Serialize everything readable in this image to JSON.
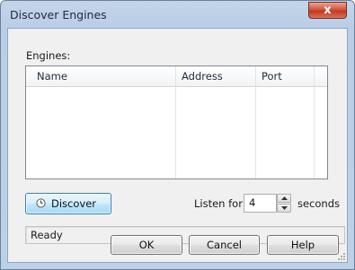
{
  "window": {
    "title": "Discover Engines",
    "close_glyph": "x"
  },
  "engines": {
    "label": "Engines:",
    "columns": [
      "Name",
      "Address",
      "Port"
    ],
    "rows": []
  },
  "discover": {
    "label": "Discover",
    "icon": "clock-icon"
  },
  "listen": {
    "label": "Listen for",
    "value": "4",
    "unit": "seconds"
  },
  "status": {
    "text": "Ready"
  },
  "buttons": {
    "ok": "OK",
    "cancel": "Cancel",
    "help": "Help"
  },
  "colors": {
    "accent": "#3c7fb1",
    "close_red": "#c23a22",
    "frame": "#bcd0e8"
  }
}
